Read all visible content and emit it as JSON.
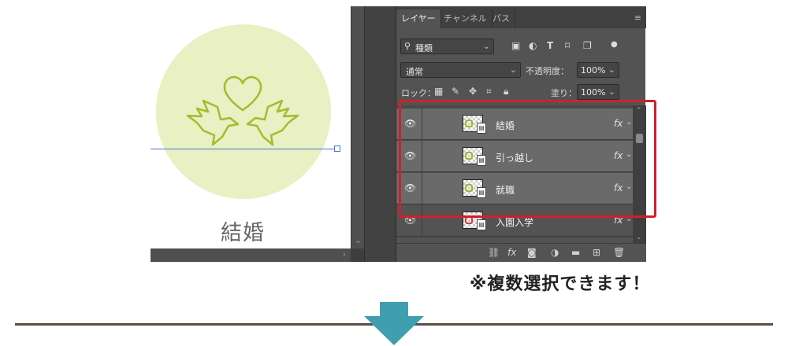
{
  "canvas": {
    "label": "結婚",
    "circle_color": "#e8f0c4",
    "motif_color": "#a4bc2c",
    "guide_color": "#4a78c8"
  },
  "panel": {
    "tabs": [
      {
        "label": "レイヤー",
        "active": true
      },
      {
        "label": "チャンネル",
        "active": false
      },
      {
        "label": "パス",
        "active": false
      }
    ],
    "menu_icon": "panel-menu-icon",
    "filter": {
      "icon": "search-icon",
      "value": "種類"
    },
    "blend_mode": "通常",
    "opacity_label": "不透明度：",
    "opacity_value": "100%",
    "lock_label": "ロック：",
    "fill_label": "塗り：",
    "fill_value": "100%",
    "layers": [
      {
        "name": "結婚",
        "selected": true,
        "fx": "fx"
      },
      {
        "name": "引っ越し",
        "selected": true,
        "fx": "fx"
      },
      {
        "name": "就職",
        "selected": true,
        "fx": "fx"
      },
      {
        "name": "入園入学",
        "selected": false,
        "fx": "fx"
      }
    ],
    "bottom_icons": [
      "link-icon",
      "fx-icon",
      "mask-icon",
      "adjustment-icon",
      "folder-icon",
      "new-layer-icon",
      "trash-icon"
    ],
    "fx_text": "fx"
  },
  "highlight_color": "#d21f2a",
  "note": "※複数選択できます！",
  "arrow_color": "#3f9fae",
  "divider_color": "#5a4d45"
}
